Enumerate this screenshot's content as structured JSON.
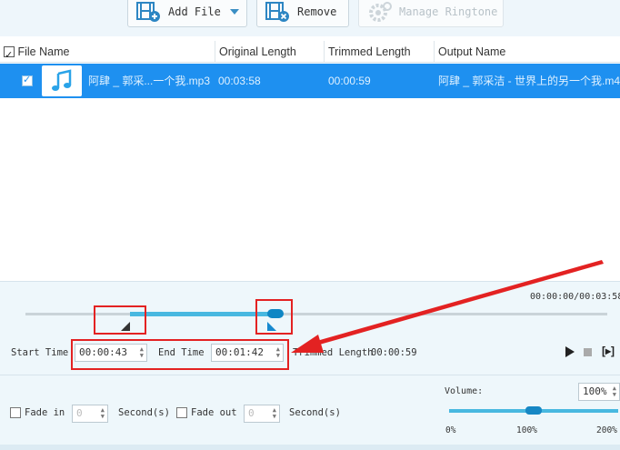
{
  "toolbar": {
    "add_file": "Add File",
    "remove": "Remove",
    "manage_ringtone": "Manage Ringtone"
  },
  "table": {
    "headers": {
      "file_name": "File Name",
      "original_length": "Original Length",
      "trimmed_length": "Trimmed Length",
      "output_name": "Output Name"
    },
    "row": {
      "file_name": "阿肆 _ 郭采...一个我.mp3",
      "original_length": "00:03:58",
      "trimmed_length": "00:00:59",
      "output_name": "阿肆 _ 郭采洁 - 世界上的另一个我.m4r"
    }
  },
  "trimmer": {
    "position_readout": "00:00:00/00:03:58",
    "start_time_label": "Start Time",
    "start_time": "00:00:43",
    "end_time_label": "End Time",
    "end_time": "00:01:42",
    "trimmed_length_label": "Trimmed Length",
    "trimmed_length": "00:00:59",
    "start_fraction": 0.18,
    "end_fraction": 0.43
  },
  "effects": {
    "fade_in_label": "Fade in",
    "fade_in_value": "0",
    "fade_in_unit": "Second(s)",
    "fade_out_label": "Fade out",
    "fade_out_value": "0",
    "fade_out_unit": "Second(s)"
  },
  "volume": {
    "label": "Volume:",
    "value": "100%",
    "min_label": "0%",
    "mid_label": "100%",
    "max_label": "200%",
    "level_fraction": 0.5
  },
  "colors": {
    "accent": "#1e90f0",
    "slider": "#48b8e0",
    "annotation": "#e32222"
  }
}
